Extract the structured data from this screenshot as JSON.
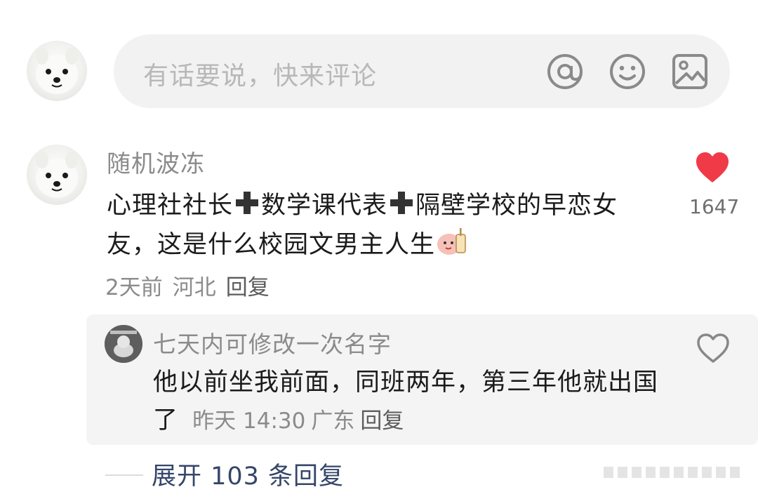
{
  "composer": {
    "placeholder": "有话要说，快来评论",
    "icons": [
      "at-icon",
      "emoji-icon",
      "image-icon"
    ]
  },
  "comment": {
    "username": "随机波冻",
    "text_parts": [
      "心理社社长",
      "数学课代表",
      "隔壁学校的早恋女友，这是什么校园文男主人生"
    ],
    "time": "2天前",
    "location": "河北",
    "reply_label": "回复",
    "like_count": "1647",
    "like_color": "#f03a47"
  },
  "reply": {
    "username": "七天内可修改一次名字",
    "text": "他以前坐我前面，同班两年，第三年他就出国了",
    "time": "昨天 14:30",
    "location": "广东",
    "reply_label": "回复"
  },
  "expand": {
    "label": "展开 103 条回复"
  }
}
